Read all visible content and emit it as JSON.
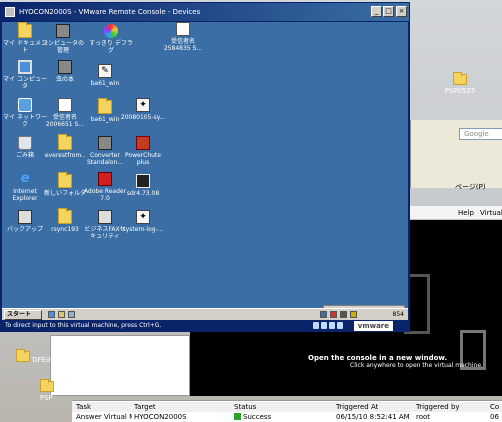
{
  "host": {
    "desktop_icons": [
      {
        "label": "PSP0525",
        "icon": "folder-icon"
      },
      {
        "label": "DFEdit",
        "icon": "folder-icon"
      },
      {
        "label": "PSP",
        "icon": "folder-icon"
      }
    ]
  },
  "browser": {
    "search_placeholder": "Google",
    "tools_label": "ページ(P)"
  },
  "client_menu": {
    "items": [
      "Help",
      "Virtual"
    ]
  },
  "console": {
    "open_title": "Open the console in a new window.",
    "open_sub": "Click anywhere to open the virtual machine."
  },
  "tasks": {
    "columns": [
      "Task",
      "Target",
      "Status",
      "Triggered At",
      "Triggered by",
      "Co"
    ],
    "rows": [
      {
        "task": "Answer Virtual Mach",
        "target": "HYOCON2000S",
        "status": "Success",
        "triggered_at": "06/15/10 8:52:41 AM",
        "triggered_by": "root",
        "co": "06"
      }
    ]
  },
  "vm_window": {
    "title": "HYOCON2000S - VMware Remote Console - Devices",
    "status_text": "To direct input to this virtual machine, press Ctrl+G.",
    "logo": "vmware",
    "buttons": {
      "minimize": "_",
      "maximize": "□",
      "close": "×"
    }
  },
  "guest": {
    "icons": [
      {
        "label": "マイ ドキュメント",
        "icon": "folder-icon"
      },
      {
        "label": "コンピュータの管理",
        "icon": "computer-management-icon"
      },
      {
        "label": "すっきり デフラグ",
        "icon": "defrag-icon"
      },
      {
        "label": "受信者名 2584835 S...",
        "icon": "document-icon"
      },
      {
        "label": "マイ コンピュータ",
        "icon": "computer-icon"
      },
      {
        "label": "虫の本",
        "icon": "tool-icon"
      },
      {
        "label": "ba61_win",
        "icon": "app-icon"
      },
      {
        "label": "マイ ネットワーク",
        "icon": "network-icon"
      },
      {
        "label": "受信者名 2006651 S...",
        "icon": "document-icon"
      },
      {
        "label": "ba61_win",
        "icon": "folder-icon"
      },
      {
        "label": "20080105-sy...",
        "icon": "app-icon"
      },
      {
        "label": "ごみ箱",
        "icon": "recycle-bin-icon"
      },
      {
        "label": "everestfrom..",
        "icon": "folder-icon"
      },
      {
        "label": "Converter Standalon...",
        "icon": "converter-icon"
      },
      {
        "label": "PowerChute plus",
        "icon": "powerchute-icon"
      },
      {
        "label": "Internet Explorer",
        "icon": "internet-explorer-icon"
      },
      {
        "label": "新しいフォルダ",
        "icon": "folder-icon"
      },
      {
        "label": "Adobe Reader 7.0",
        "icon": "adobe-reader-icon"
      },
      {
        "label": "sdr4.73.08",
        "icon": "console-icon"
      },
      {
        "label": "バックアップ",
        "icon": "backup-icon"
      },
      {
        "label": "rsync193",
        "icon": "folder-icon"
      },
      {
        "label": "ビジネスFAXセキュリティ",
        "icon": "fax-icon"
      },
      {
        "label": "system-log-...",
        "icon": "app-icon"
      }
    ],
    "start_label": "スタート",
    "clock": "854",
    "floating_bar": "▢ ⊞ ⊡ ⊞ ◎ ▢ ▣ ◉ ◔"
  }
}
